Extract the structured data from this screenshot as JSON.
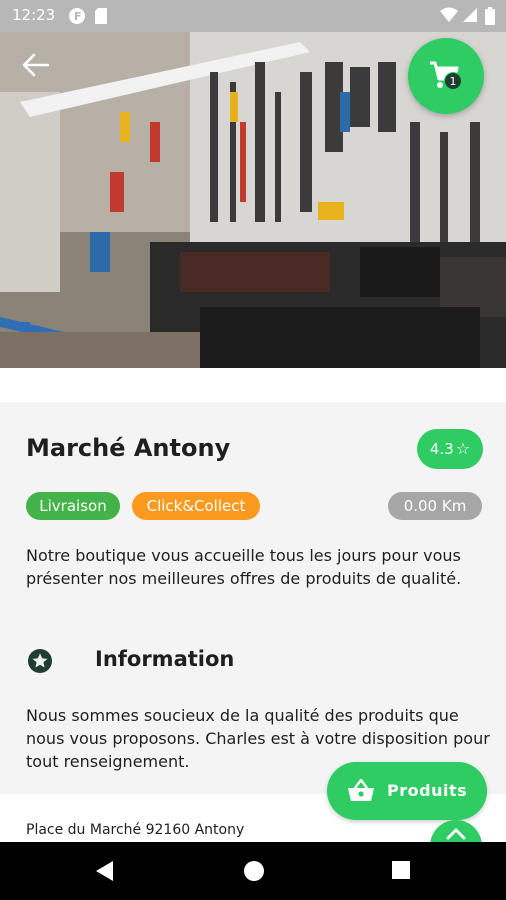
{
  "status_bar": {
    "time": "12:23",
    "icons": [
      "notification-f-icon",
      "sd-card-icon",
      "wifi-icon",
      "signal-icon",
      "battery-icon"
    ]
  },
  "header": {
    "back_icon": "arrow-left-icon",
    "cart_icon": "shopping-cart-icon",
    "cart_count": "1"
  },
  "store": {
    "name": "Marché Antony",
    "rating": "4.3",
    "rating_icon": "star-outline-icon",
    "tags": [
      "Livraison",
      "Click&Collect"
    ],
    "distance": "0.00 Km",
    "description": "Notre boutique vous accueille tous les jours pour vous présenter nos meilleures offres de produits de qualité."
  },
  "information": {
    "icon": "star-circle-icon",
    "title": "Information",
    "text": "Nous sommes soucieux de la qualité des produits que nous vous proposons. Charles est à votre disposition pour tout renseignement."
  },
  "address": "Place du Marché 92160 Antony",
  "products_button": {
    "label": "Produits",
    "icon": "basket-icon"
  },
  "scroll_top_icon": "chevron-up-icon",
  "nav_bar": [
    "back-triangle-icon",
    "home-circle-icon",
    "recents-square-icon"
  ],
  "colors": {
    "accent_green": "#2ecc63",
    "livraison_green": "#43b349",
    "click_orange": "#fb9a1e",
    "distance_grey": "#a7a7a7",
    "dark_green_icon": "#1f3e30"
  }
}
